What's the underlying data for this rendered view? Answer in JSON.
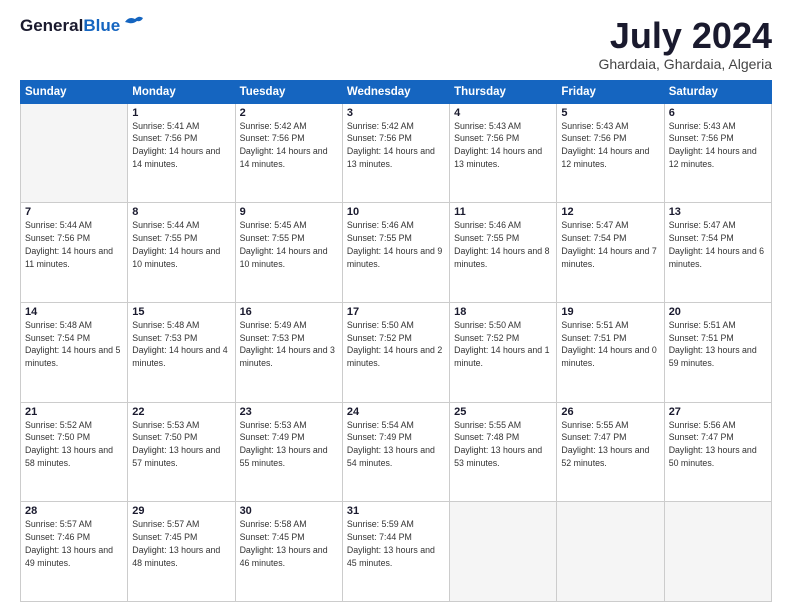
{
  "header": {
    "logo_general": "General",
    "logo_blue": "Blue",
    "month_title": "July 2024",
    "subtitle": "Ghardaia, Ghardaia, Algeria"
  },
  "weekdays": [
    "Sunday",
    "Monday",
    "Tuesday",
    "Wednesday",
    "Thursday",
    "Friday",
    "Saturday"
  ],
  "weeks": [
    [
      {
        "day": "",
        "empty": true
      },
      {
        "day": "1",
        "sunrise": "Sunrise: 5:41 AM",
        "sunset": "Sunset: 7:56 PM",
        "daylight": "Daylight: 14 hours and 14 minutes."
      },
      {
        "day": "2",
        "sunrise": "Sunrise: 5:42 AM",
        "sunset": "Sunset: 7:56 PM",
        "daylight": "Daylight: 14 hours and 14 minutes."
      },
      {
        "day": "3",
        "sunrise": "Sunrise: 5:42 AM",
        "sunset": "Sunset: 7:56 PM",
        "daylight": "Daylight: 14 hours and 13 minutes."
      },
      {
        "day": "4",
        "sunrise": "Sunrise: 5:43 AM",
        "sunset": "Sunset: 7:56 PM",
        "daylight": "Daylight: 14 hours and 13 minutes."
      },
      {
        "day": "5",
        "sunrise": "Sunrise: 5:43 AM",
        "sunset": "Sunset: 7:56 PM",
        "daylight": "Daylight: 14 hours and 12 minutes."
      },
      {
        "day": "6",
        "sunrise": "Sunrise: 5:43 AM",
        "sunset": "Sunset: 7:56 PM",
        "daylight": "Daylight: 14 hours and 12 minutes."
      }
    ],
    [
      {
        "day": "7",
        "sunrise": "Sunrise: 5:44 AM",
        "sunset": "Sunset: 7:56 PM",
        "daylight": "Daylight: 14 hours and 11 minutes."
      },
      {
        "day": "8",
        "sunrise": "Sunrise: 5:44 AM",
        "sunset": "Sunset: 7:55 PM",
        "daylight": "Daylight: 14 hours and 10 minutes."
      },
      {
        "day": "9",
        "sunrise": "Sunrise: 5:45 AM",
        "sunset": "Sunset: 7:55 PM",
        "daylight": "Daylight: 14 hours and 10 minutes."
      },
      {
        "day": "10",
        "sunrise": "Sunrise: 5:46 AM",
        "sunset": "Sunset: 7:55 PM",
        "daylight": "Daylight: 14 hours and 9 minutes."
      },
      {
        "day": "11",
        "sunrise": "Sunrise: 5:46 AM",
        "sunset": "Sunset: 7:55 PM",
        "daylight": "Daylight: 14 hours and 8 minutes."
      },
      {
        "day": "12",
        "sunrise": "Sunrise: 5:47 AM",
        "sunset": "Sunset: 7:54 PM",
        "daylight": "Daylight: 14 hours and 7 minutes."
      },
      {
        "day": "13",
        "sunrise": "Sunrise: 5:47 AM",
        "sunset": "Sunset: 7:54 PM",
        "daylight": "Daylight: 14 hours and 6 minutes."
      }
    ],
    [
      {
        "day": "14",
        "sunrise": "Sunrise: 5:48 AM",
        "sunset": "Sunset: 7:54 PM",
        "daylight": "Daylight: 14 hours and 5 minutes."
      },
      {
        "day": "15",
        "sunrise": "Sunrise: 5:48 AM",
        "sunset": "Sunset: 7:53 PM",
        "daylight": "Daylight: 14 hours and 4 minutes."
      },
      {
        "day": "16",
        "sunrise": "Sunrise: 5:49 AM",
        "sunset": "Sunset: 7:53 PM",
        "daylight": "Daylight: 14 hours and 3 minutes."
      },
      {
        "day": "17",
        "sunrise": "Sunrise: 5:50 AM",
        "sunset": "Sunset: 7:52 PM",
        "daylight": "Daylight: 14 hours and 2 minutes."
      },
      {
        "day": "18",
        "sunrise": "Sunrise: 5:50 AM",
        "sunset": "Sunset: 7:52 PM",
        "daylight": "Daylight: 14 hours and 1 minute."
      },
      {
        "day": "19",
        "sunrise": "Sunrise: 5:51 AM",
        "sunset": "Sunset: 7:51 PM",
        "daylight": "Daylight: 14 hours and 0 minutes."
      },
      {
        "day": "20",
        "sunrise": "Sunrise: 5:51 AM",
        "sunset": "Sunset: 7:51 PM",
        "daylight": "Daylight: 13 hours and 59 minutes."
      }
    ],
    [
      {
        "day": "21",
        "sunrise": "Sunrise: 5:52 AM",
        "sunset": "Sunset: 7:50 PM",
        "daylight": "Daylight: 13 hours and 58 minutes."
      },
      {
        "day": "22",
        "sunrise": "Sunrise: 5:53 AM",
        "sunset": "Sunset: 7:50 PM",
        "daylight": "Daylight: 13 hours and 57 minutes."
      },
      {
        "day": "23",
        "sunrise": "Sunrise: 5:53 AM",
        "sunset": "Sunset: 7:49 PM",
        "daylight": "Daylight: 13 hours and 55 minutes."
      },
      {
        "day": "24",
        "sunrise": "Sunrise: 5:54 AM",
        "sunset": "Sunset: 7:49 PM",
        "daylight": "Daylight: 13 hours and 54 minutes."
      },
      {
        "day": "25",
        "sunrise": "Sunrise: 5:55 AM",
        "sunset": "Sunset: 7:48 PM",
        "daylight": "Daylight: 13 hours and 53 minutes."
      },
      {
        "day": "26",
        "sunrise": "Sunrise: 5:55 AM",
        "sunset": "Sunset: 7:47 PM",
        "daylight": "Daylight: 13 hours and 52 minutes."
      },
      {
        "day": "27",
        "sunrise": "Sunrise: 5:56 AM",
        "sunset": "Sunset: 7:47 PM",
        "daylight": "Daylight: 13 hours and 50 minutes."
      }
    ],
    [
      {
        "day": "28",
        "sunrise": "Sunrise: 5:57 AM",
        "sunset": "Sunset: 7:46 PM",
        "daylight": "Daylight: 13 hours and 49 minutes."
      },
      {
        "day": "29",
        "sunrise": "Sunrise: 5:57 AM",
        "sunset": "Sunset: 7:45 PM",
        "daylight": "Daylight: 13 hours and 48 minutes."
      },
      {
        "day": "30",
        "sunrise": "Sunrise: 5:58 AM",
        "sunset": "Sunset: 7:45 PM",
        "daylight": "Daylight: 13 hours and 46 minutes."
      },
      {
        "day": "31",
        "sunrise": "Sunrise: 5:59 AM",
        "sunset": "Sunset: 7:44 PM",
        "daylight": "Daylight: 13 hours and 45 minutes."
      },
      {
        "day": "",
        "empty": true
      },
      {
        "day": "",
        "empty": true
      },
      {
        "day": "",
        "empty": true
      }
    ]
  ]
}
